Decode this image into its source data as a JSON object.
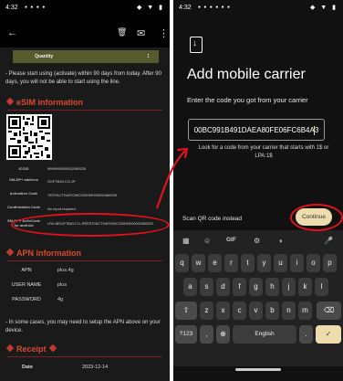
{
  "left": {
    "status_time": "4:32",
    "status_dots": "● ● ● ●",
    "status_icons": "◆ ▼ ▮",
    "toolbar": {
      "back": "←",
      "delete": "🗑",
      "mail": "✉",
      "more": "⋮"
    },
    "quantity_label": "Quantity",
    "quantity_value": "1",
    "activate_notice": "- Please start using (activate) within 90 days from today. After 90 days, you will not be able to start using the line.",
    "esim_heading": "eSIM information",
    "esim_rows": [
      {
        "key": "ICCID",
        "value": "9999999000002080025"
      },
      {
        "key": "SM-DP+ address",
        "value": "SOFTBAY.CO.JP"
      },
      {
        "key": "Activation Code",
        "value": "TESTACTIVATIONCODE99000002080025"
      },
      {
        "key": "Confirmation Code",
        "value": "No input required"
      },
      {
        "key": "SM-DP+ ActivCode for android",
        "value": "LPA:1$SOFTBAY.CO.JP$TESTACTIVATIONCODE99000002080025"
      }
    ],
    "apn_heading": "APN information",
    "apn_rows": [
      {
        "key": "APN",
        "value": "plus.4g"
      },
      {
        "key": "USER NAME",
        "value": "plus"
      },
      {
        "key": "PASSWORD",
        "value": "4g"
      }
    ],
    "apn_notice": "- In some cases, you may need to setup the APN above on your device.",
    "receipt_heading": "Receipt",
    "date_label": "Date",
    "date_value": "2023-12-14"
  },
  "right": {
    "status_time": "4:32",
    "status_dots": "● ● ● ● ● ●",
    "status_icons": "◆ ▼ ▮",
    "title": "Add mobile carrier",
    "subtitle": "Enter the code you got from your carrier",
    "code_value": "00BC991B491DAEA80FE06FC6B4A3",
    "hint": "Look for a code from your carrier that starts with 1$ or LPA:1$",
    "scan_link": "Scan QR code instead",
    "continue_label": "Continue",
    "keyboard": {
      "toolbar": {
        "grid": "▦",
        "sticker": "☺",
        "gif": "GIF",
        "gear": "⚙",
        "palette": "◐",
        "mic": "🎤"
      },
      "row1": [
        "q",
        "w",
        "e",
        "r",
        "t",
        "y",
        "u",
        "i",
        "o",
        "p"
      ],
      "row2": [
        "a",
        "s",
        "d",
        "f",
        "g",
        "h",
        "j",
        "k",
        "l"
      ],
      "row3": [
        "z",
        "x",
        "c",
        "v",
        "b",
        "n",
        "m"
      ],
      "shift": "⇧",
      "backspace": "⌫",
      "symbols": "?123",
      "comma": ",",
      "globe": "⊕",
      "space": "English",
      "period": ".",
      "enter": "✓"
    }
  },
  "colors": {
    "accent_red": "#e0121b",
    "section_red": "#d94a2d",
    "continue_bg": "#ecdcae"
  }
}
